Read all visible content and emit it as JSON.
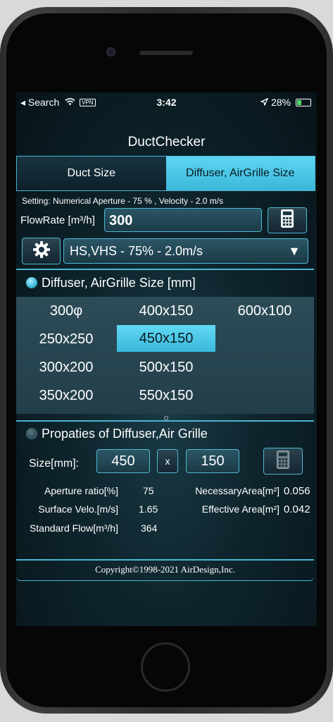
{
  "status": {
    "back": "◂ Search",
    "vpn": "VPN",
    "time": "3:42",
    "location_icon": "location-arrow-icon",
    "battery": "28%"
  },
  "app": {
    "title": "DuctChecker"
  },
  "tabs": [
    {
      "label": "Duct Size"
    },
    {
      "label": "Diffuser, AirGrille Size"
    }
  ],
  "setting": {
    "text": "Setting: Numerical Aperture -  75 % , Velocity -   2.0 m/s"
  },
  "flowrate": {
    "label": "FlowRate [m³/h]",
    "value": "300"
  },
  "selector": {
    "value": "HS,VHS - 75% - 2.0m/s",
    "arrow": "▼"
  },
  "sizes": {
    "header": "Diffuser, AirGrille Size [mm]",
    "items": [
      "300φ",
      "400x150",
      "600x100",
      "250x250",
      "450x150",
      "300x200",
      "500x150",
      "350x200",
      "550x150"
    ],
    "selected": "450x150"
  },
  "props": {
    "header": "Propaties of Diffuser,Air Grille",
    "size_label": "Size[mm]:",
    "width": "450",
    "x": "x",
    "height": "150",
    "aperture_label": "Aperture ratio[%]",
    "aperture_value": "75",
    "surface_label": "Surface Velo.[m/s]",
    "surface_value": "1.65",
    "standard_label": "Standard Flow[m³/h]",
    "standard_value": "364",
    "necessary_label": "NecessaryArea[m²]",
    "necessary_value": "0.056",
    "effective_label": "Effective Area[m²]",
    "effective_value": "0.042"
  },
  "footer": {
    "copyright": "Copyright©1998-2021 AirDesign,Inc."
  },
  "colors": {
    "accent": "#4ab5d0",
    "selected": "#3bb7da",
    "background": "#0e242c"
  }
}
